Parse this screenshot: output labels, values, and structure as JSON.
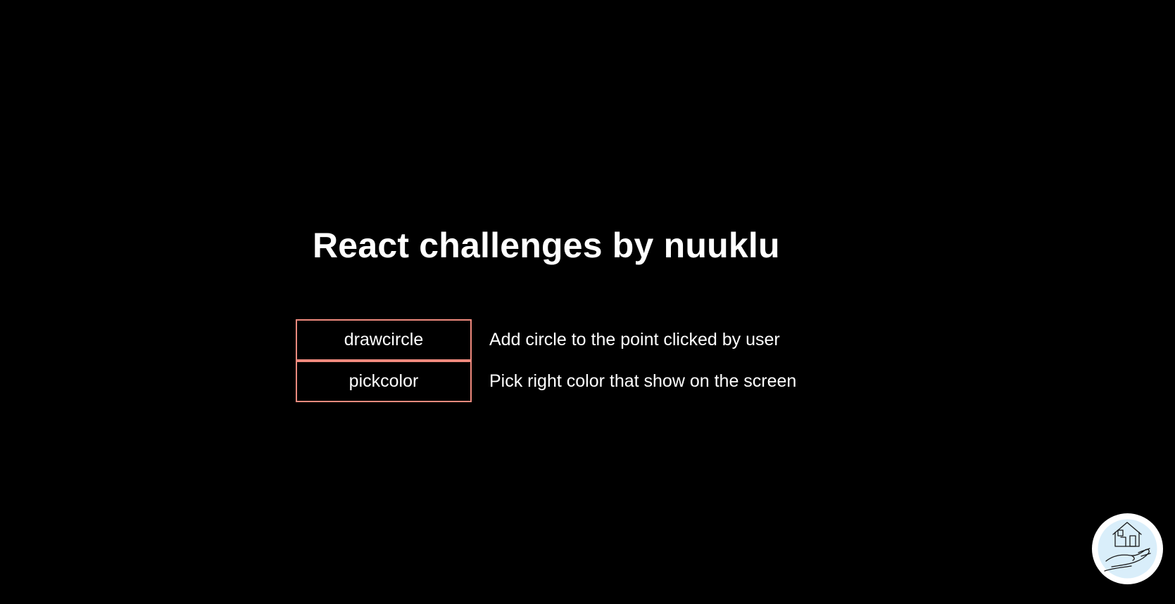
{
  "page": {
    "title": "React challenges by nuuklu"
  },
  "challenges": [
    {
      "label": "drawcircle",
      "description": "Add circle to the point clicked by user"
    },
    {
      "label": "pickcolor",
      "description": "Pick right color that show on the screen"
    }
  ],
  "home_badge": {
    "icon": "house-in-hand-icon"
  },
  "colors": {
    "background": "#000000",
    "text": "#ffffff",
    "button_border": "#f08a7e",
    "badge_background": "#ffffff",
    "badge_accent": "#d9eefa"
  }
}
